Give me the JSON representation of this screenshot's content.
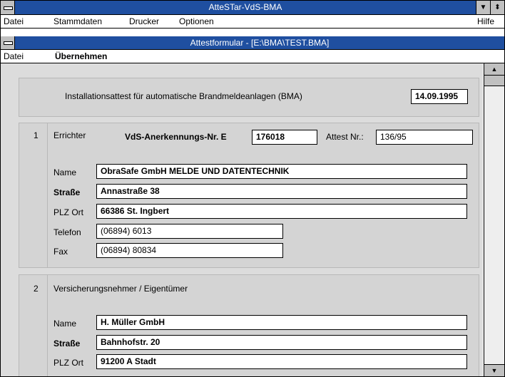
{
  "app": {
    "title": "AtteSTar-VdS-BMA",
    "menu": [
      "Datei",
      "Stammdaten",
      "Drucker",
      "Optionen"
    ],
    "help": "Hilfe"
  },
  "doc": {
    "title": "Attestformular - [E:\\BMA\\TEST.BMA]",
    "menu": [
      "Datei",
      "Übernehmen"
    ]
  },
  "form": {
    "heading": "Installationsattest für automatische Brandmeldeanlagen (BMA)",
    "date": "14.09.1995",
    "section1": {
      "number": "1",
      "label": "Errichter",
      "vds_label": "VdS-Anerkennungs-Nr. E",
      "vds_value": "176018",
      "attest_label": "Attest Nr.:",
      "attest_value": "136/95",
      "name_label": "Name",
      "name_value": "ObraSafe GmbH MELDE UND DATENTECHNIK",
      "street_label": "Straße",
      "street_value": "Annastraße 38",
      "city_label": "PLZ Ort",
      "city_value": "66386 St. Ingbert",
      "phone_label": "Telefon",
      "phone_value": "(06894) 6013",
      "fax_label": "Fax",
      "fax_value": "(06894) 80834"
    },
    "section2": {
      "number": "2",
      "label": "Versicherungsnehmer / Eigentümer",
      "name_label": "Name",
      "name_value": "H. Müller GmbH",
      "street_label": "Straße",
      "street_value": "Bahnhofstr. 20",
      "city_label": "PLZ Ort",
      "city_value": "91200 A Stadt"
    }
  }
}
